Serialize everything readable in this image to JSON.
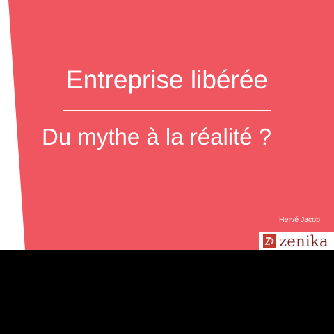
{
  "slide": {
    "title": "Entreprise libérée",
    "subtitle": "Du mythe à la réalité ?",
    "author": "Hervé Jacob",
    "logo_text": "zenika"
  },
  "colors": {
    "accent": "#f05660",
    "text": "#ffffff",
    "logo_text": "#7a1f24",
    "letterbox": "#000000"
  },
  "icons": {
    "logo": "zenika-logo-icon"
  }
}
